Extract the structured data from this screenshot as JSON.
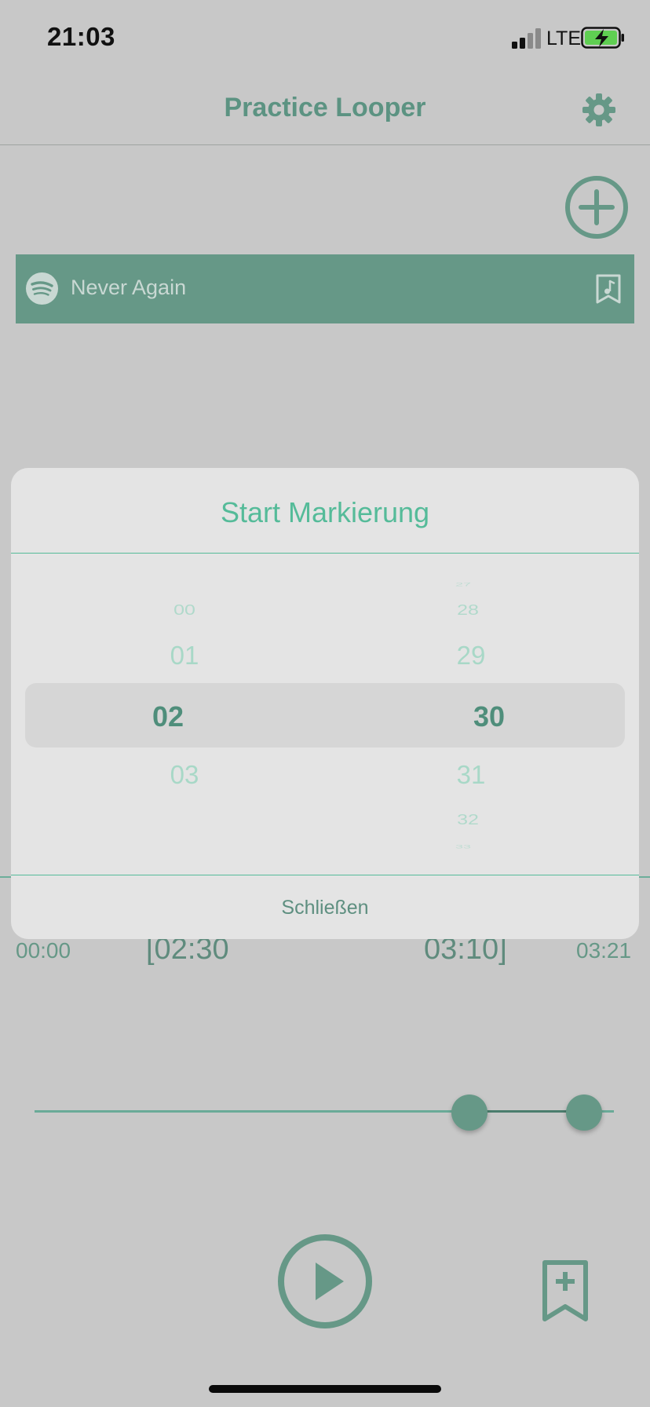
{
  "status_bar": {
    "time": "21:03",
    "network": "LTE"
  },
  "nav": {
    "title": "Practice Looper"
  },
  "tracks": [
    {
      "name": "Never Again"
    }
  ],
  "player": {
    "time_start": "00:00",
    "loop_start": "[02:30",
    "loop_end": "03:10]",
    "time_end": "03:21"
  },
  "modal": {
    "title": "Start Markierung",
    "minutes": {
      "prev2": "00",
      "prev1": "01",
      "selected": "02",
      "next1": "03"
    },
    "seconds": {
      "prev3": "27",
      "prev2": "28",
      "prev1": "29",
      "selected": "30",
      "next1": "31",
      "next2": "32",
      "next3": "33"
    },
    "close_label": "Schließen"
  },
  "colors": {
    "accent": "#669887",
    "accent_light": "#55bb99",
    "background": "#c8c8c8",
    "modal_background": "#e4e4e4"
  }
}
